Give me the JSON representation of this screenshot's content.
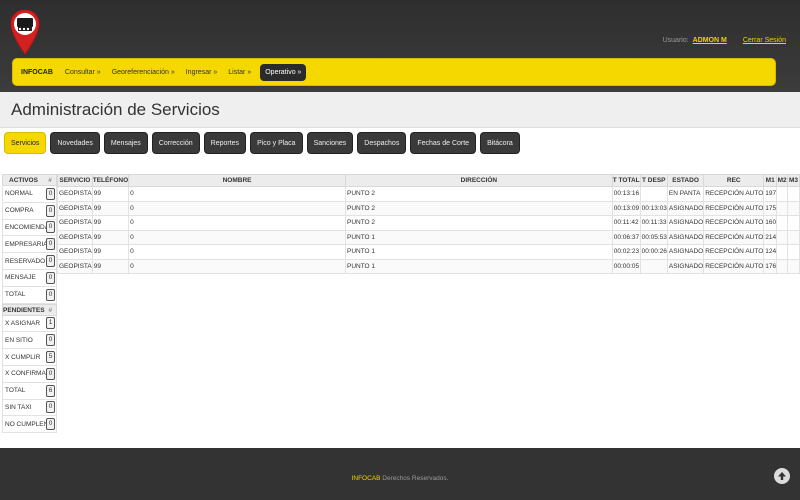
{
  "header": {
    "user_label": "Usuario:",
    "user_name": "ADMON M",
    "logout_label": "Cerrar Sesión"
  },
  "nav": {
    "brand": "INFOCAB",
    "items": [
      {
        "label": "Consultar »"
      },
      {
        "label": "Georeferenciación »"
      },
      {
        "label": "Ingresar »"
      },
      {
        "label": "Listar »"
      },
      {
        "label": "Operativo »"
      }
    ]
  },
  "page": {
    "title": "Administración de Servicios"
  },
  "tabs": [
    {
      "label": "Servicios"
    },
    {
      "label": "Novedades"
    },
    {
      "label": "Mensajes"
    },
    {
      "label": "Corrección"
    },
    {
      "label": "Reportes"
    },
    {
      "label": "Pico y Placa"
    },
    {
      "label": "Sanciones"
    },
    {
      "label": "Despachos"
    },
    {
      "label": "Fechas de Corte"
    },
    {
      "label": "Bitácora"
    }
  ],
  "activos": {
    "header": "ACTIVOS",
    "hash": "#",
    "rows": [
      {
        "label": "NORMAL",
        "count": "0"
      },
      {
        "label": "COMPRA",
        "count": "0"
      },
      {
        "label": "ENCOMIENDA",
        "count": "0"
      },
      {
        "label": "EMPRESARIAL",
        "count": "0"
      },
      {
        "label": "RESERVADO",
        "count": "0"
      },
      {
        "label": "MENSAJE",
        "count": "0"
      },
      {
        "label": "TOTAL",
        "count": "0"
      }
    ]
  },
  "pendientes": {
    "header": "PENDIENTES",
    "hash": "#",
    "rows": [
      {
        "label": "X ASIGNAR",
        "count": "1"
      },
      {
        "label": "EN SITIO",
        "count": "0"
      },
      {
        "label": "X CUMPLIR",
        "count": "5"
      },
      {
        "label": "X CONFIRMAR",
        "count": "0"
      },
      {
        "label": "TOTAL",
        "count": "6"
      },
      {
        "label": "SIN TAXI",
        "count": "0"
      },
      {
        "label": "NO CUMPLEN",
        "count": "0"
      }
    ]
  },
  "grid": {
    "columns": [
      "SERVICIO",
      "TELÉFONO",
      "NOMBRE",
      "DIRECCIÓN",
      "T TOTAL",
      "T DESP",
      "ESTADO",
      "REC",
      "M1",
      "M2",
      "M3"
    ],
    "rows": [
      [
        "GEOPISTA",
        "99",
        "0",
        "PUNTO 2",
        "00:13:16",
        "",
        "EN PANTA",
        "RECEPCIÓN AUTO",
        "197",
        "",
        ""
      ],
      [
        "GEOPISTA",
        "99",
        "0",
        "PUNTO 2",
        "00:13:09",
        "00:13:03",
        "ASIGNADO",
        "RECEPCIÓN AUTO",
        "175",
        "",
        ""
      ],
      [
        "GEOPISTA",
        "99",
        "0",
        "PUNTO 2",
        "00:11:42",
        "00:11:33",
        "ASIGNADO",
        "RECEPCIÓN AUTO",
        "160",
        "",
        ""
      ],
      [
        "GEOPISTA",
        "99",
        "0",
        "PUNTO 1",
        "00:06:37",
        "00:05:53",
        "ASIGNADO",
        "RECEPCIÓN AUTO",
        "214",
        "",
        ""
      ],
      [
        "GEOPISTA",
        "99",
        "0",
        "PUNTO 1",
        "00:02:23",
        "00:00:26",
        "ASIGNADO",
        "RECEPCIÓN AUTO",
        "124",
        "",
        ""
      ],
      [
        "GEOPISTA",
        "99",
        "0",
        "PUNTO 1",
        "00:00:05",
        "",
        "ASIGNADO",
        "RECEPCIÓN AUTO",
        "176",
        "",
        ""
      ]
    ]
  },
  "footer": {
    "brand": "INFOCAB",
    "text": " Derechos Reservados."
  },
  "colors": {
    "accent": "#f5d800",
    "dark": "#3a3a3a"
  },
  "icons": {
    "logo": "taxi-pin-logo-icon",
    "scroll_top": "arrow-up-icon"
  }
}
